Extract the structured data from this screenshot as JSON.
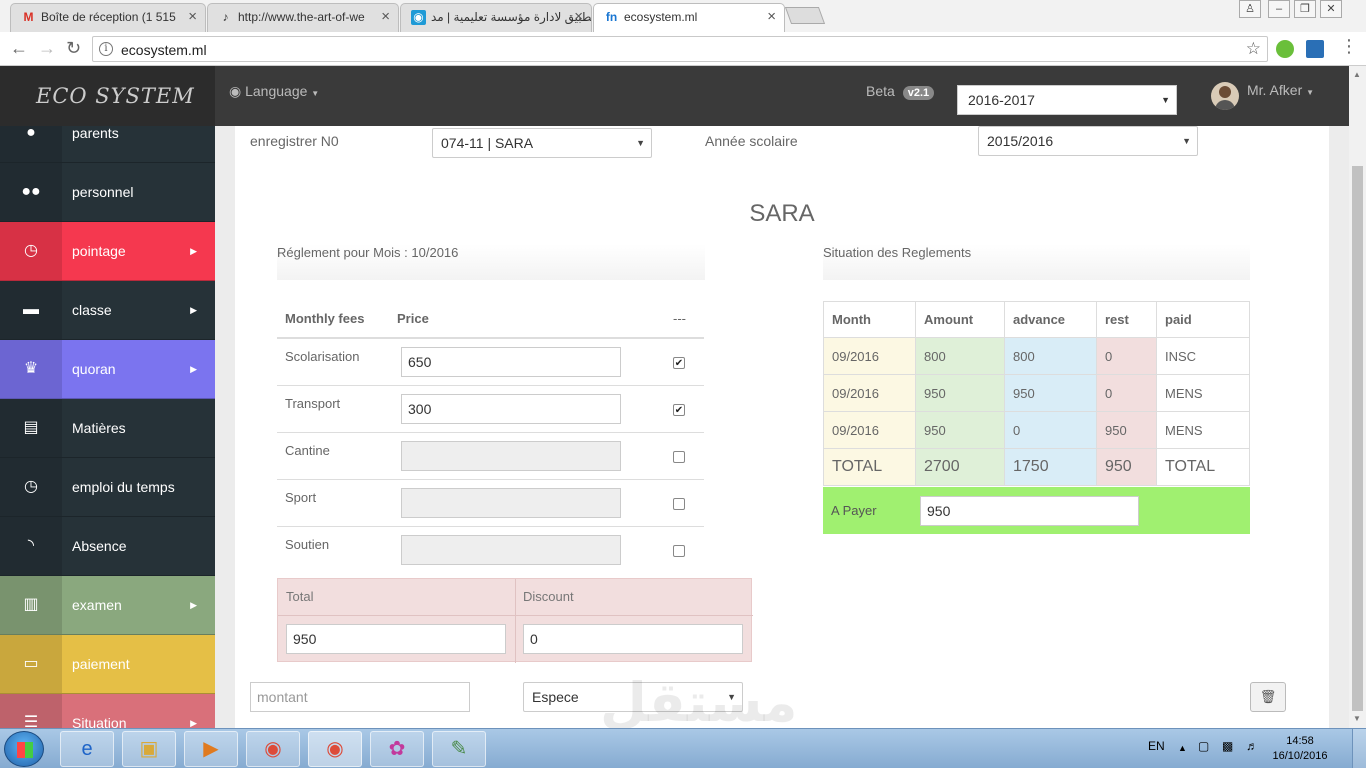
{
  "browser": {
    "tabs": [
      {
        "title": "Boîte de réception (1 515",
        "favicon": "M"
      },
      {
        "title": "http://www.the-art-of-we",
        "favicon": "♪"
      },
      {
        "title": "تطبيق لادارة مؤسسة تعليمية | مد",
        "favicon": "◉"
      },
      {
        "title": "ecosystem.ml",
        "favicon": "fn"
      }
    ],
    "url": "ecosystem.ml"
  },
  "app": {
    "brand": "ECO SYSTEM",
    "language_label": "Language",
    "beta_label": "Beta",
    "version": "v2.1",
    "year_select": "2016-2017",
    "user_name": "Mr. Afker"
  },
  "sidebar": {
    "items": [
      {
        "label": "parents",
        "icon": "user-icon",
        "glyph": "●",
        "color": "#263238",
        "arrow": false
      },
      {
        "label": "personnel",
        "icon": "users-icon",
        "glyph": "●●",
        "color": "#263238",
        "arrow": false
      },
      {
        "label": "pointage",
        "icon": "clock-icon",
        "glyph": "◷",
        "color": "#f5384f",
        "arrow": true
      },
      {
        "label": "classe",
        "icon": "briefcase-icon",
        "glyph": "▬",
        "color": "#263238",
        "arrow": true
      },
      {
        "label": "quoran",
        "icon": "trophy-icon",
        "glyph": "♛",
        "color": "#7b74ef",
        "arrow": true
      },
      {
        "label": "Matières",
        "icon": "book-icon",
        "glyph": "▤",
        "color": "#263238",
        "arrow": false
      },
      {
        "label": "emploi du temps",
        "icon": "clock-icon",
        "glyph": "◷",
        "color": "#263238",
        "arrow": false
      },
      {
        "label": "Absence",
        "icon": "rss-icon",
        "glyph": "◝",
        "color": "#263238",
        "arrow": false
      },
      {
        "label": "examen",
        "icon": "bar-chart-icon",
        "glyph": "▥",
        "color": "#8aa87e",
        "arrow": true
      },
      {
        "label": "paiement",
        "icon": "credit-card-icon",
        "glyph": "▭",
        "color": "#e5bf46",
        "arrow": false
      },
      {
        "label": "Situation",
        "icon": "list-icon",
        "glyph": "☰",
        "color": "#d9707a",
        "arrow": true
      }
    ]
  },
  "form": {
    "register_label": "enregistrer N0",
    "register_value": "074-11 | SARA",
    "school_year_label": "Année scolaire",
    "school_year_value": "2015/2016",
    "student_name": "SARA"
  },
  "fees": {
    "title": "Réglement pour Mois : 10/2016",
    "headers": [
      "Monthly fees",
      "Price",
      "---"
    ],
    "rows": [
      {
        "name": "Scolarisation",
        "price": "650",
        "checked": true
      },
      {
        "name": "Transport",
        "price": "300",
        "checked": true
      },
      {
        "name": "Cantine",
        "price": "",
        "checked": false
      },
      {
        "name": "Sport",
        "price": "",
        "checked": false
      },
      {
        "name": "Soutien",
        "price": "",
        "checked": false
      }
    ],
    "total_label": "Total",
    "total_value": "950",
    "discount_label": "Discount",
    "discount_value": "0"
  },
  "situation": {
    "title": "Situation des Reglements",
    "headers": [
      "Month",
      "Amount",
      "advance",
      "rest",
      "paid"
    ],
    "rows": [
      [
        "09/2016",
        "800",
        "800",
        "0",
        "INSC"
      ],
      [
        "09/2016",
        "950",
        "950",
        "0",
        "MENS"
      ],
      [
        "09/2016",
        "950",
        "0",
        "950",
        "MENS"
      ]
    ],
    "totals": [
      "TOTAL",
      "2700",
      "1750",
      "950",
      "TOTAL"
    ],
    "a_payer_label": "A Payer",
    "a_payer_value": "950"
  },
  "payment": {
    "amount_placeholder": "montant",
    "method": "Espece"
  },
  "watermark": "مستقل",
  "taskbar": {
    "lang": "EN",
    "time": "14:58",
    "date": "16/10/2016"
  }
}
